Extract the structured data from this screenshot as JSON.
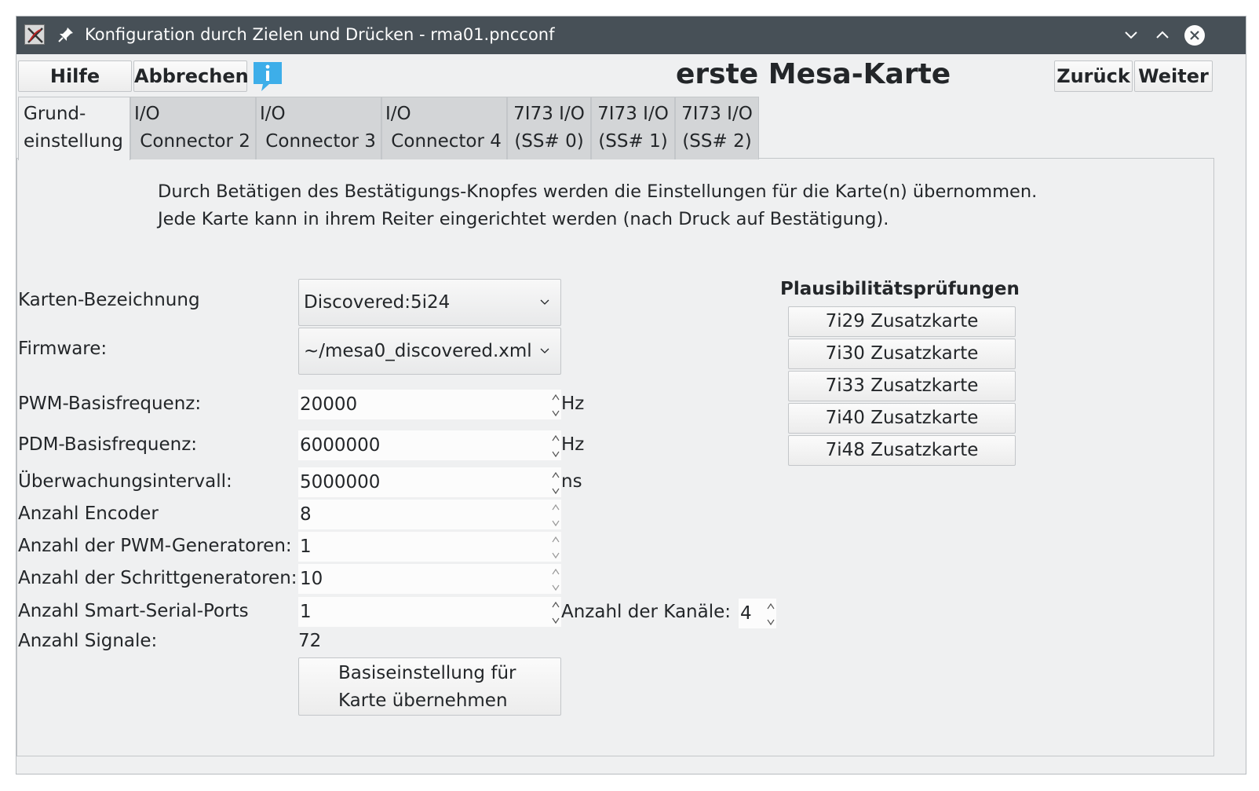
{
  "window": {
    "title": "Konfiguration durch Zielen und Drücken - rma01.pncconf"
  },
  "toolbar": {
    "help_label": "Hilfe",
    "cancel_label": "Abbrechen",
    "back_label": "Zurück",
    "next_label": "Weiter"
  },
  "page": {
    "title": "erste Mesa-Karte",
    "intro_line1": "Durch Betätigen des Bestätigungs-Knopfes werden die Einstellungen für die Karte(n) übernommen.",
    "intro_line2": "Jede Karte kann in ihrem Reiter eingerichtet werden (nach Druck auf Bestätigung)."
  },
  "tabs": [
    {
      "line1": "Grund-",
      "line2": "einstellung"
    },
    {
      "line1": "I/O",
      "line2": " Connector 2"
    },
    {
      "line1": "I/O",
      "line2": " Connector 3"
    },
    {
      "line1": "I/O",
      "line2": " Connector 4"
    },
    {
      "line1": "7I73 I/O",
      "line2": "(SS# 0)"
    },
    {
      "line1": "7I73 I/O",
      "line2": "(SS# 1)"
    },
    {
      "line1": "7I73 I/O",
      "line2": "(SS# 2)"
    }
  ],
  "form": {
    "card_name_label": "Karten-Bezeichnung",
    "card_name_value": "Discovered:5i24",
    "firmware_label": "Firmware:",
    "firmware_value": "~/mesa0_discovered.xml",
    "pwm_freq_label": "PWM-Basisfrequenz:",
    "pwm_freq_value": "20000",
    "pwm_freq_unit": "Hz",
    "pdm_freq_label": "PDM-Basisfrequenz:",
    "pdm_freq_value": "6000000",
    "pdm_freq_unit": "Hz",
    "watchdog_label": "Überwachungsintervall:",
    "watchdog_value": "5000000",
    "watchdog_unit": "ns",
    "encoders_label": "Anzahl Encoder",
    "encoders_value": "8",
    "pwm_gens_label": "Anzahl der PWM-Generatoren:",
    "pwm_gens_value": "1",
    "step_gens_label": "Anzahl der Schrittgeneratoren:",
    "step_gens_value": "10",
    "sserial_label": "Anzahl Smart-Serial-Ports",
    "sserial_value": "1",
    "channels_label": "Anzahl der Kanäle:",
    "channels_value": "4",
    "signals_label": "Anzahl Signale:",
    "signals_value": "72",
    "apply_line1": "Basiseinstellung für",
    "apply_line2": "Karte übernehmen"
  },
  "checks": {
    "title": "Plausibilitätsprüfungen",
    "buttons": [
      "7i29 Zusatzkarte",
      "7i30 Zusatzkarte",
      "7i33 Zusatzkarte",
      "7i40 Zusatzkarte",
      "7i48 Zusatzkarte"
    ]
  },
  "colors": {
    "titlebar": "#475057",
    "window_bg": "#eff0f1",
    "info_blue": "#3daee9"
  }
}
